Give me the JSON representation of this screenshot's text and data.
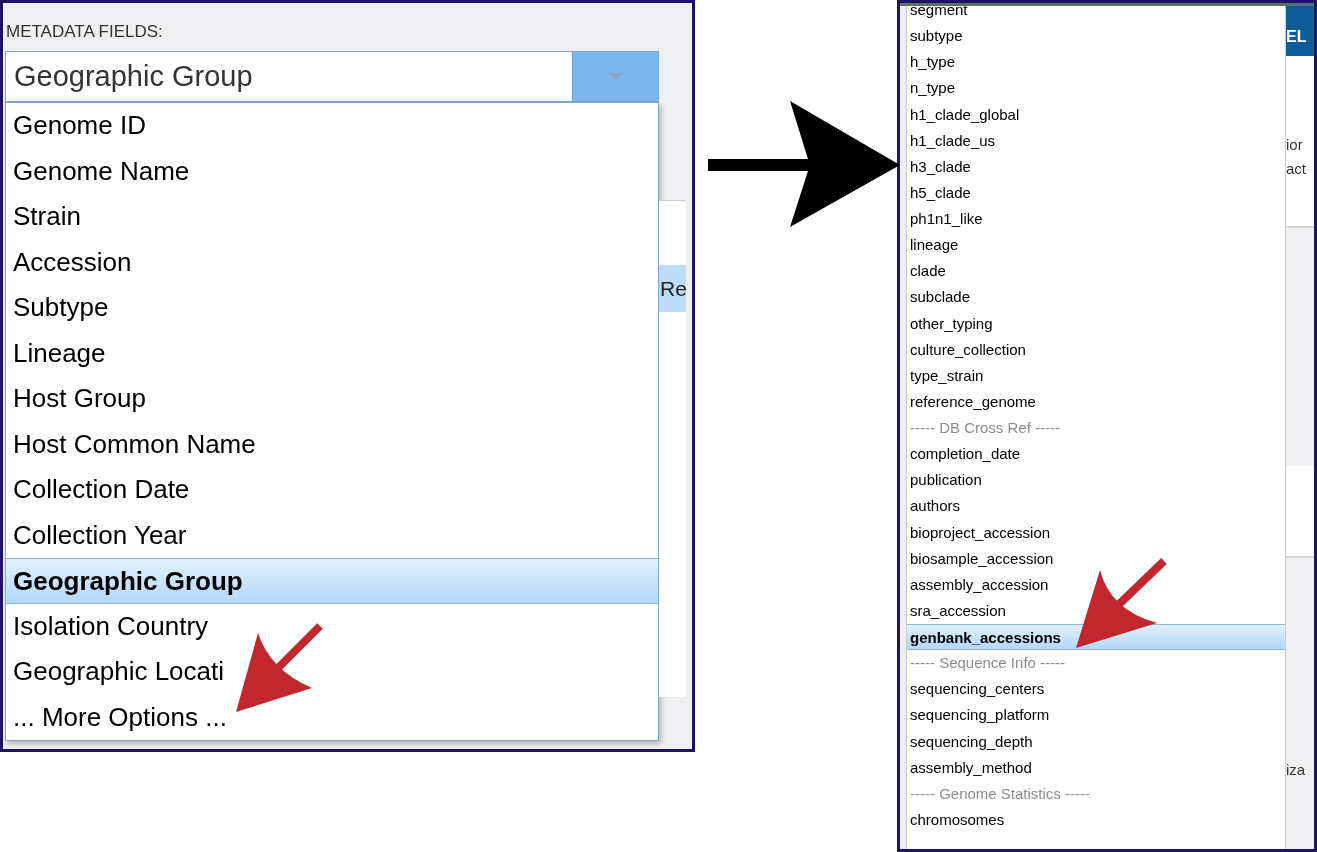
{
  "left_panel": {
    "label": "METADATA FIELDS:",
    "select": {
      "value": "Geographic Group"
    },
    "options": [
      {
        "label": "Genome ID",
        "selected": false
      },
      {
        "label": "Genome Name",
        "selected": false
      },
      {
        "label": "Strain",
        "selected": false
      },
      {
        "label": "Accession",
        "selected": false
      },
      {
        "label": "Subtype",
        "selected": false
      },
      {
        "label": "Lineage",
        "selected": false
      },
      {
        "label": "Host Group",
        "selected": false
      },
      {
        "label": "Host Common Name",
        "selected": false
      },
      {
        "label": "Collection Date",
        "selected": false
      },
      {
        "label": "Collection Year",
        "selected": false
      },
      {
        "label": "Geographic Group",
        "selected": true
      },
      {
        "label": "Isolation Country",
        "selected": false
      },
      {
        "label": "Geographic Locati",
        "selected": false
      },
      {
        "label": "... More Options ...",
        "selected": false
      }
    ],
    "background_button": "Re"
  },
  "right_panel": {
    "header_fragment": "EL",
    "options": [
      {
        "label": "segment",
        "kind": "option",
        "selected": false
      },
      {
        "label": "subtype",
        "kind": "option",
        "selected": false
      },
      {
        "label": "h_type",
        "kind": "option",
        "selected": false
      },
      {
        "label": "n_type",
        "kind": "option",
        "selected": false
      },
      {
        "label": "h1_clade_global",
        "kind": "option",
        "selected": false
      },
      {
        "label": "h1_clade_us",
        "kind": "option",
        "selected": false
      },
      {
        "label": "h3_clade",
        "kind": "option",
        "selected": false
      },
      {
        "label": "h5_clade",
        "kind": "option",
        "selected": false
      },
      {
        "label": "ph1n1_like",
        "kind": "option",
        "selected": false
      },
      {
        "label": "lineage",
        "kind": "option",
        "selected": false
      },
      {
        "label": "clade",
        "kind": "option",
        "selected": false
      },
      {
        "label": "subclade",
        "kind": "option",
        "selected": false
      },
      {
        "label": "other_typing",
        "kind": "option",
        "selected": false
      },
      {
        "label": "culture_collection",
        "kind": "option",
        "selected": false
      },
      {
        "label": "type_strain",
        "kind": "option",
        "selected": false
      },
      {
        "label": "reference_genome",
        "kind": "option",
        "selected": false
      },
      {
        "label": "----- DB Cross Ref -----",
        "kind": "group",
        "selected": false
      },
      {
        "label": "completion_date",
        "kind": "option",
        "selected": false
      },
      {
        "label": "publication",
        "kind": "option",
        "selected": false
      },
      {
        "label": "authors",
        "kind": "option",
        "selected": false
      },
      {
        "label": "bioproject_accession",
        "kind": "option",
        "selected": false
      },
      {
        "label": "biosample_accession",
        "kind": "option",
        "selected": false
      },
      {
        "label": "assembly_accession",
        "kind": "option",
        "selected": false
      },
      {
        "label": "sra_accession",
        "kind": "option",
        "selected": false
      },
      {
        "label": "genbank_accessions",
        "kind": "option",
        "selected": true
      },
      {
        "label": "----- Sequence Info -----",
        "kind": "group",
        "selected": false
      },
      {
        "label": "sequencing_centers",
        "kind": "option",
        "selected": false
      },
      {
        "label": "sequencing_platform",
        "kind": "option",
        "selected": false
      },
      {
        "label": "sequencing_depth",
        "kind": "option",
        "selected": false
      },
      {
        "label": "assembly_method",
        "kind": "option",
        "selected": false
      },
      {
        "label": "----- Genome Statistics -----",
        "kind": "group",
        "selected": false
      },
      {
        "label": "chromosomes",
        "kind": "option",
        "selected": false
      }
    ],
    "side_fragments": [
      "ior",
      "act"
    ],
    "lower_fragment": "iza"
  }
}
